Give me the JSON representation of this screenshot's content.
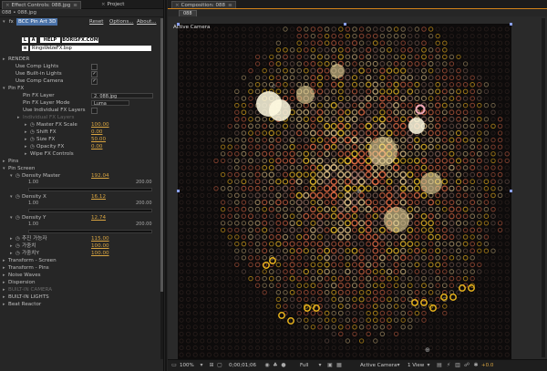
{
  "left_panel": {
    "tabs": [
      {
        "label": "Effect Controls: 088.jpg",
        "active": true
      },
      {
        "label": "Project",
        "active": false
      }
    ],
    "layer_path": "088 • 088.jpg",
    "effect": {
      "name": "BCC Pin Art 3D",
      "fx_label": "fx",
      "reset_label": "Reset",
      "options_label": "Options...",
      "about_label": "About...",
      "logo_help": "HELP",
      "logo_site": "BORISFX.COM",
      "preset_file": "RingsVelzeFX.bsp"
    },
    "rows": [
      {
        "label": "RENDER",
        "indent": 0,
        "tri": "▸"
      },
      {
        "label": "Use Comp Lights",
        "indent": 1,
        "check": ""
      },
      {
        "label": "Use Built-in Lights",
        "indent": 1,
        "check": "✓"
      },
      {
        "label": "Use Comp Camera",
        "indent": 1,
        "check": "✓"
      },
      {
        "label": "Pin FX",
        "indent": 0,
        "tri": "▾"
      },
      {
        "label": "Pin FX Layer",
        "indent": 2,
        "dropdown": "2. 088.jpg"
      },
      {
        "label": "Pin FX Layer Mode",
        "indent": 2,
        "dropdown": "Luma"
      },
      {
        "label": "Use Individual FX Layers",
        "indent": 2,
        "check": ""
      },
      {
        "label": "Individual FX Layers",
        "indent": 2,
        "tri": "▸",
        "dim": true
      },
      {
        "label": "Master FX Scale",
        "indent": 3,
        "tri": "▸",
        "stopwatch": true,
        "value": "100.00"
      },
      {
        "label": "Shift FX",
        "indent": 3,
        "tri": "▸",
        "stopwatch": true,
        "value": "0.00"
      },
      {
        "label": "Size FX",
        "indent": 3,
        "tri": "▸",
        "stopwatch": true,
        "value": "50.00"
      },
      {
        "label": "Opacity FX",
        "indent": 3,
        "tri": "▸",
        "stopwatch": true,
        "value": "0.00"
      },
      {
        "label": "Wipe FX Controls",
        "indent": 3,
        "tri": "▸"
      },
      {
        "label": "Pins",
        "indent": 0,
        "tri": "▸"
      },
      {
        "label": "Pin Screen",
        "indent": 0,
        "tri": "▾"
      },
      {
        "label": "Density Master",
        "indent": 1,
        "tri": "▾",
        "stopwatch": true,
        "value": "192.04",
        "slider": true,
        "min": "1.00",
        "max": "200.00"
      },
      {
        "label": "Density X",
        "indent": 1,
        "tri": "▾",
        "stopwatch": true,
        "value": "16.12",
        "slider": true,
        "min": "1.00",
        "max": "200.00"
      },
      {
        "label": "Density Y",
        "indent": 1,
        "tri": "▾",
        "stopwatch": true,
        "value": "12.74",
        "slider": true,
        "min": "1.00",
        "max": "200.00"
      },
      {
        "label": "추진 가능자",
        "indent": 1,
        "tri": "▸",
        "stopwatch": true,
        "value": "115.00"
      },
      {
        "label": "가중치",
        "indent": 1,
        "tri": "▸",
        "stopwatch": true,
        "value": "100.00"
      },
      {
        "label": "가중치Y",
        "indent": 1,
        "tri": "▸",
        "stopwatch": true,
        "value": "100.00"
      },
      {
        "label": "Transform - Screen",
        "indent": 0,
        "tri": "▸"
      },
      {
        "label": "Transform - Pins",
        "indent": 0,
        "tri": "▸"
      },
      {
        "label": "Noise Waves",
        "indent": 0,
        "tri": "▸"
      },
      {
        "label": "Dispersion",
        "indent": 0,
        "tri": "▸"
      },
      {
        "label": "BUILT-IN CAMERA",
        "indent": 0,
        "tri": "▸",
        "dim": true
      },
      {
        "label": "BUILT-IN LIGHTS",
        "indent": 0,
        "tri": "▸"
      },
      {
        "label": "Beat Reactor",
        "indent": 0,
        "tri": "▸"
      }
    ]
  },
  "right_panel": {
    "tab": "Composition: 088",
    "sub_tab": "088",
    "view_label": "Active Camera",
    "bottom": {
      "zoom": "100%",
      "timecode": "0;00;01;06",
      "resolution": "Full",
      "camera": "Active Camera",
      "views": "1 View",
      "exposure": "+0.0"
    }
  },
  "colors": {
    "accent": "#d2831a",
    "value": "#d8a440",
    "highlight": "#4a72a8"
  }
}
